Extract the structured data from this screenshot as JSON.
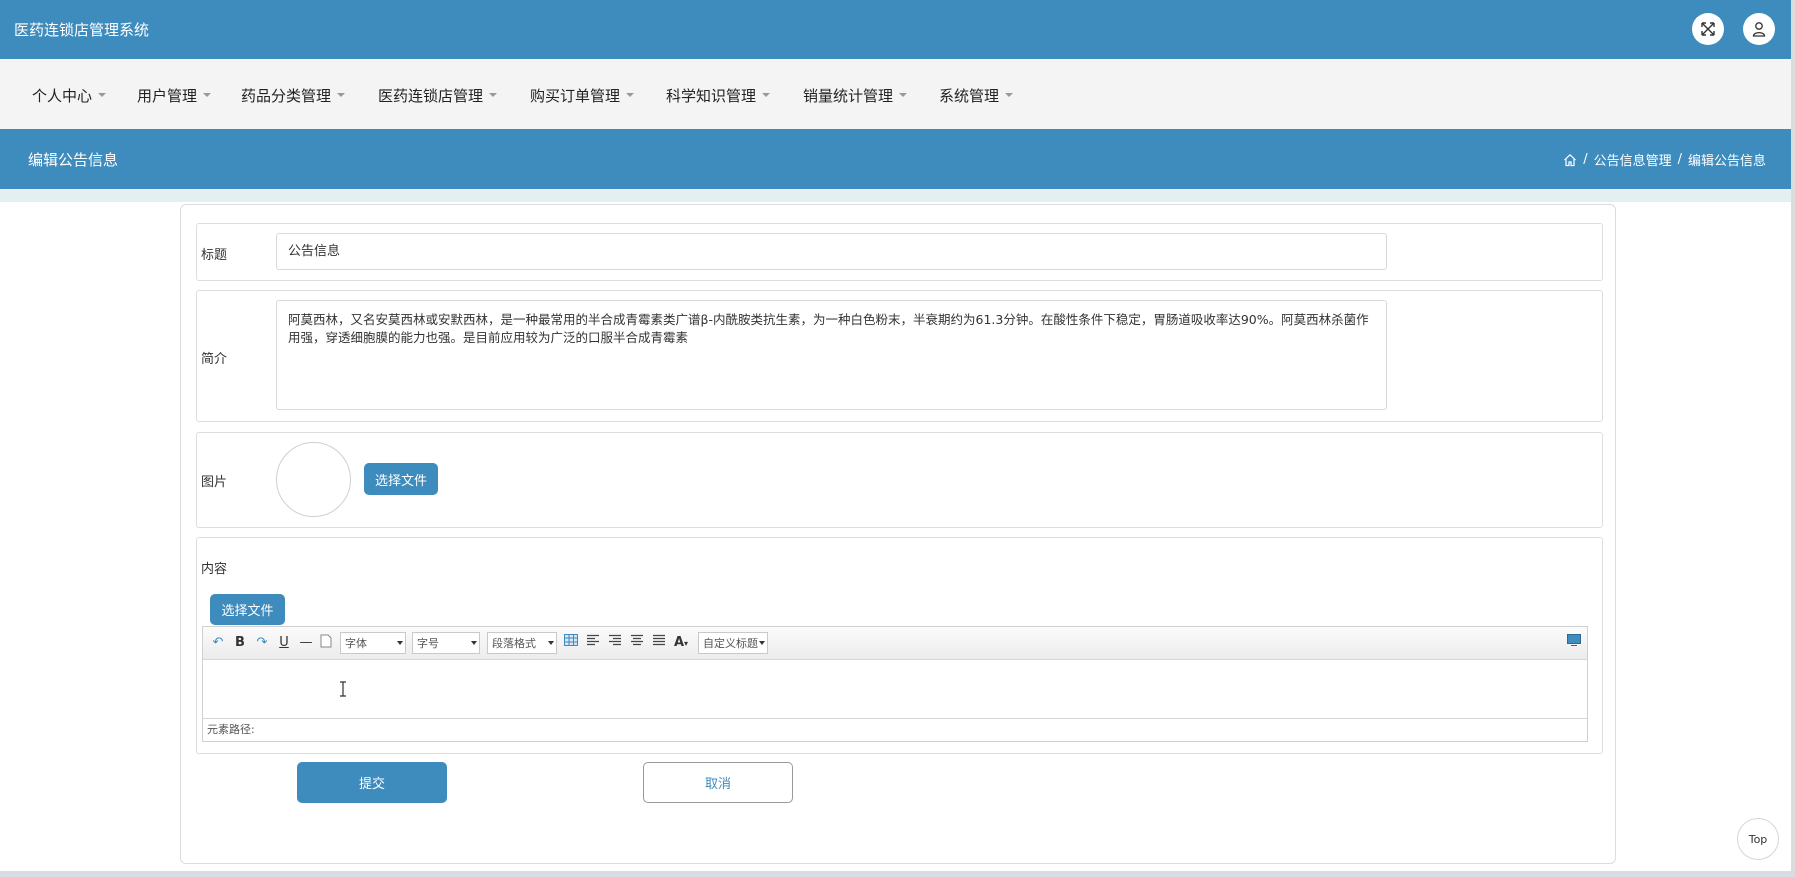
{
  "header": {
    "app_title": "医药连锁店管理系统",
    "fullscreen_icon": "expand-icon",
    "user_icon": "user-icon"
  },
  "nav": {
    "items": [
      {
        "label": "个人中心"
      },
      {
        "label": "用户管理"
      },
      {
        "label": "药品分类管理"
      },
      {
        "label": "医药连锁店管理"
      },
      {
        "label": "购买订单管理"
      },
      {
        "label": "科学知识管理"
      },
      {
        "label": "销量统计管理"
      },
      {
        "label": "系统管理"
      }
    ]
  },
  "page": {
    "title": "编辑公告信息",
    "breadcrumb": {
      "home_icon": "home-icon",
      "sep": "/",
      "parent": "公告信息管理",
      "current": "编辑公告信息"
    }
  },
  "form": {
    "title_label": "标题",
    "title_value": "公告信息",
    "intro_label": "简介",
    "intro_value": "阿莫西林，又名安莫西林或安默西林，是一种最常用的半合成青霉素类广谱β-内酰胺类抗生素，为一种白色粉末，半衰期约为61.3分钟。在酸性条件下稳定，胃肠道吸收率达90%。阿莫西林杀菌作用强，穿透细胞膜的能力也强。是目前应用较为广泛的口服半合成青霉素",
    "image_label": "图片",
    "choose_file_label": "选择文件",
    "content_label": "内容",
    "content_choose_file_label": "选择文件"
  },
  "editor": {
    "font_select": "字体",
    "size_select": "字号",
    "paragraph_select": "段落格式",
    "color_label": "A",
    "custom_title_select": "自定义标题",
    "bold": "B",
    "underline": "U",
    "hr": "—",
    "element_path_label": "元素路径:"
  },
  "actions": {
    "submit_label": "提交",
    "cancel_label": "取消",
    "top_label": "Top"
  },
  "colors": {
    "primary": "#3e8bbd",
    "nav_bg": "#f4f4f4",
    "strip": "#e4eff1"
  }
}
